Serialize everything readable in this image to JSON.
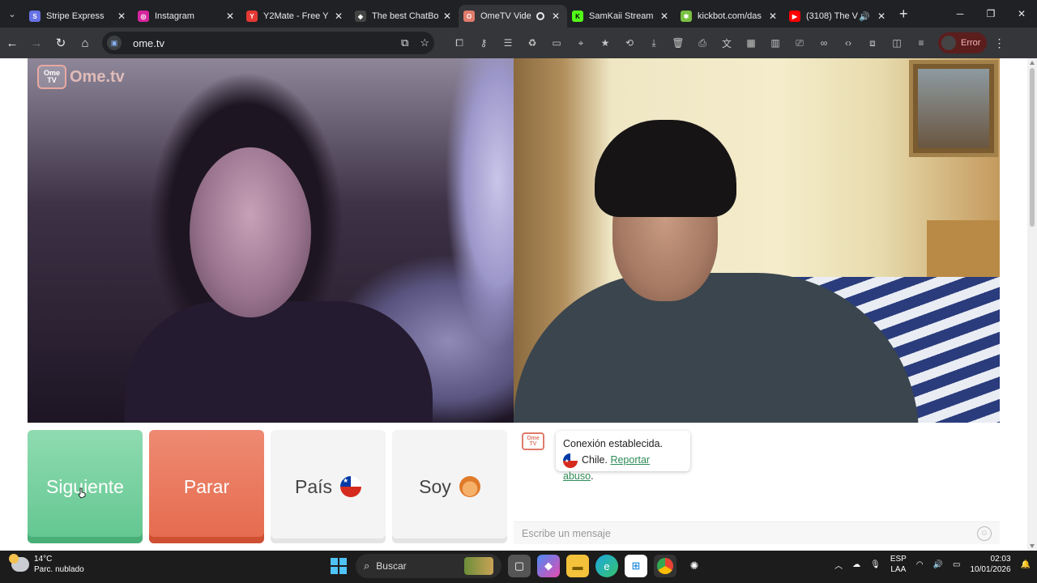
{
  "browser": {
    "tabs": [
      {
        "title": "Stripe Express",
        "color": "#6772e5",
        "glyph": "S"
      },
      {
        "title": "Instagram",
        "color": "#d6249f",
        "glyph": "◎"
      },
      {
        "title": "Y2Mate - Free Y",
        "color": "#e53935",
        "glyph": "Y"
      },
      {
        "title": "The best ChatBo",
        "color": "#444444",
        "glyph": "◆"
      },
      {
        "title": "OmeTV Vide",
        "color": "#e07b6b",
        "glyph": "O",
        "active": true
      },
      {
        "title": "SamKaii Stream",
        "color": "#53fc18",
        "glyph": "K"
      },
      {
        "title": "kickbot.com/das",
        "color": "#7ac143",
        "glyph": "✱"
      },
      {
        "title": "(3108) The V",
        "color": "#ff0000",
        "glyph": "▶"
      }
    ],
    "address": "ome.tv",
    "profile_status": "Error"
  },
  "site": {
    "logo_word": "Ome.tv",
    "logo_badge": "Ome TV"
  },
  "controls": {
    "next_label": "Siguiente",
    "stop_label": "Parar",
    "country_label": "País",
    "me_label": "Soy"
  },
  "chat": {
    "badge": "Ome TV",
    "status_text": "Conexión establecida.",
    "country_text": "Chile.",
    "report_link": "Reportar abuso",
    "report_suffix": ".",
    "input_placeholder": "Escribe un mensaje"
  },
  "taskbar": {
    "temperature": "14°C",
    "weather": "Parc. nublado",
    "search_label": "Buscar",
    "lang_top": "ESP",
    "lang_bottom": "LAA",
    "time": "02:03",
    "date": "10/01/2026"
  }
}
